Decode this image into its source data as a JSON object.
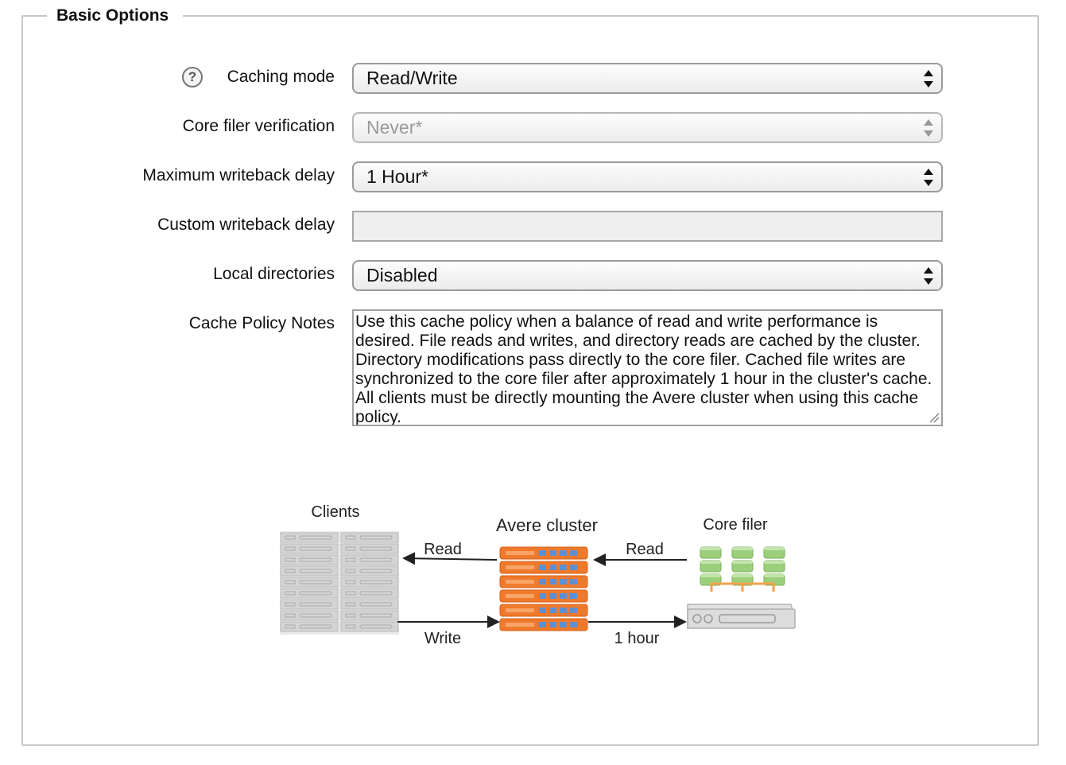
{
  "section": {
    "title": "Basic Options"
  },
  "fields": {
    "caching_mode": {
      "label": "Caching mode",
      "value": "Read/Write"
    },
    "core_filer_verification": {
      "label": "Core filer verification",
      "value": "Never*"
    },
    "max_writeback_delay": {
      "label": "Maximum writeback delay",
      "value": "1 Hour*"
    },
    "custom_writeback_delay": {
      "label": "Custom writeback delay",
      "value": ""
    },
    "local_directories": {
      "label": "Local directories",
      "value": "Disabled"
    },
    "cache_policy_notes": {
      "label": "Cache Policy Notes",
      "value": "Use this cache policy when a balance of read and write performance is desired.  File reads and writes, and directory reads are cached by the cluster.  Directory modifications pass directly to the core filer.  Cached file writes are synchronized to the core filer after approximately 1 hour in the cluster's cache.  All clients must be directly mounting the Avere cluster when using this cache policy."
    }
  },
  "help_icon": "question-mark-icon",
  "diagram": {
    "clients_label": "Clients",
    "cluster_label": "Avere cluster",
    "core_filer_label": "Core filer",
    "read_left_label": "Read",
    "read_right_label": "Read",
    "write_label": "Write",
    "writeback_label": "1 hour",
    "colors": {
      "cluster": "#f07a2c",
      "filer_disk": "#9ccf7c",
      "client": "#d4d4d4",
      "link": "#f4a24a"
    }
  }
}
